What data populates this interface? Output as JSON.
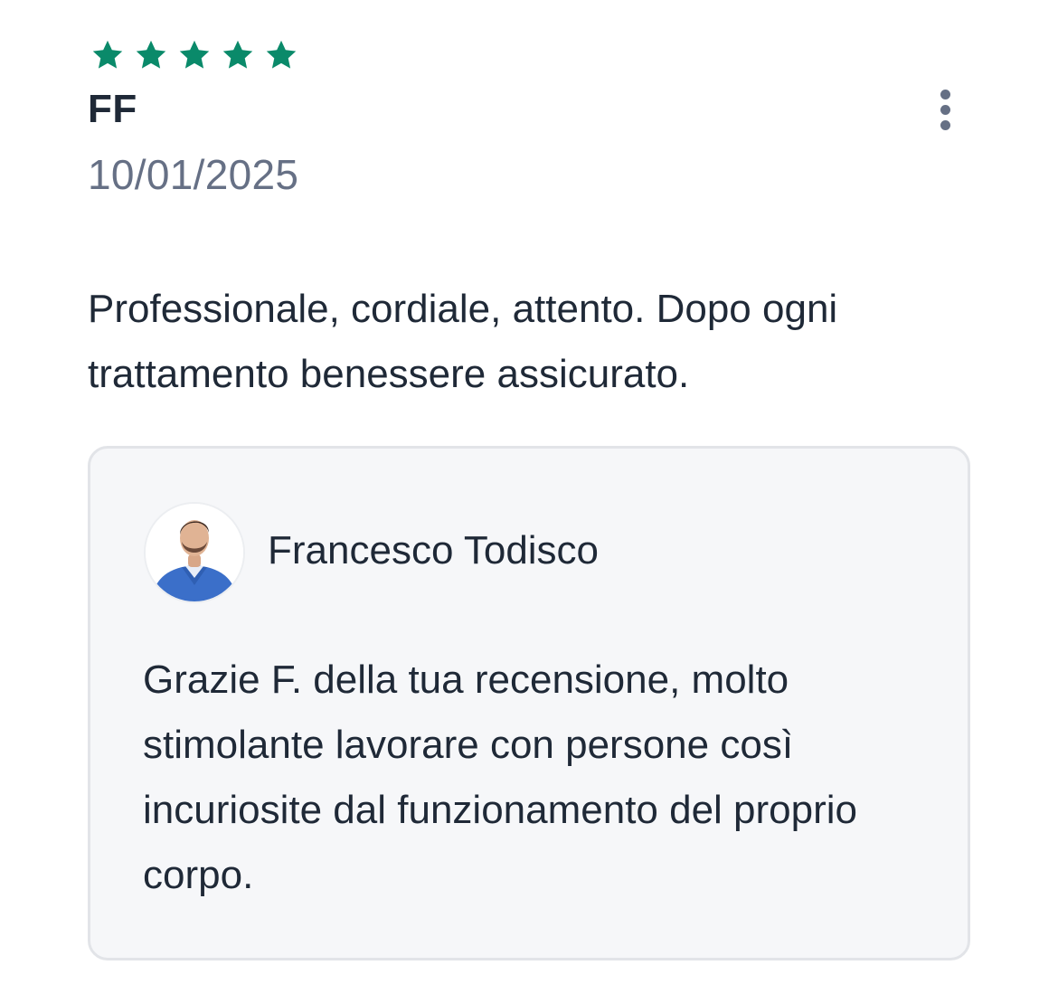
{
  "review": {
    "rating": 5,
    "rating_max": 5,
    "star_color": "#0a8a6a",
    "author": "FF",
    "date": "10/01/2025",
    "text": "Professionale, cordiale, attento. Dopo ogni trattamento benessere assicurato.",
    "menu_icon": "more-vertical-icon"
  },
  "reply": {
    "author": "Francesco Todisco",
    "avatar": "doctor-photo",
    "text": "Grazie F. della tua recensione, molto stimolante lavorare con persone così incuriosite dal funzionamento del proprio corpo."
  }
}
